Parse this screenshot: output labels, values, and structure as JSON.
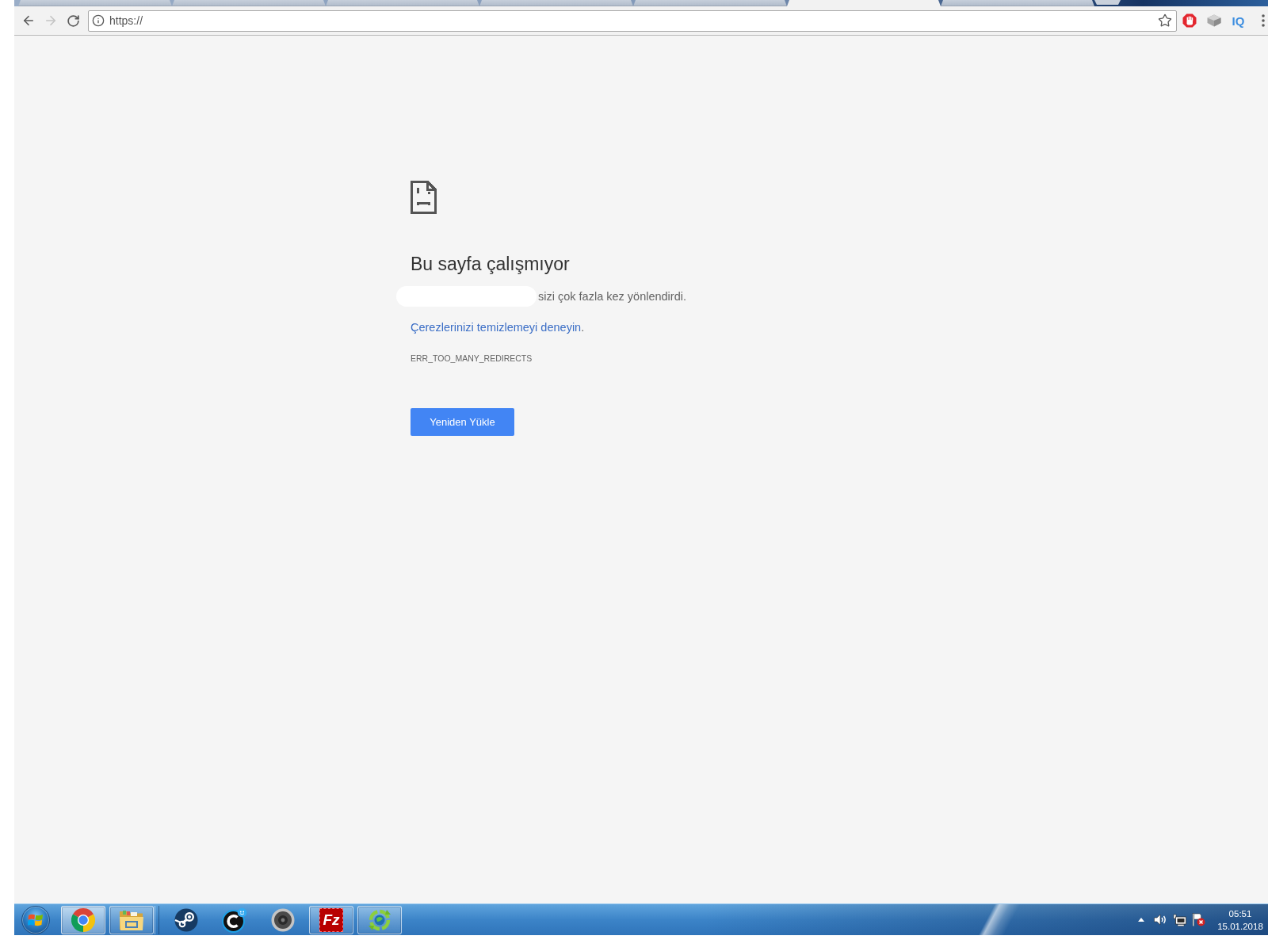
{
  "tabs": [
    {
      "selected": false
    },
    {
      "selected": false
    },
    {
      "selected": false
    },
    {
      "selected": false
    },
    {
      "selected": false
    },
    {
      "selected": true
    },
    {
      "selected": false
    }
  ],
  "nav_buttons": [
    {
      "kind": "back",
      "disabled": false
    },
    {
      "kind": "forward",
      "disabled": true
    },
    {
      "kind": "reload",
      "disabled": false
    }
  ],
  "address_bar": {
    "url": "https://"
  },
  "extension_label": "IQ",
  "error_page": {
    "heading": "Bu sayfa çalışmıyor",
    "message": "sizi çok fazla kez yönlendirdi.",
    "suggestion_link": "Çerezlerinizi temizlemeyi deneyin",
    "suggestion_end": ".",
    "error_code": "ERR_TOO_MANY_REDIRECTS",
    "button": "Yeniden Yükle"
  },
  "taskbar": {
    "items": [
      {
        "kind": "browser",
        "running": true,
        "active": true
      },
      {
        "kind": "folder",
        "running": true,
        "active": false
      },
      {
        "kind": "round-logo",
        "running": false,
        "active": false
      },
      {
        "kind": "ring-logo",
        "running": false,
        "active": false
      },
      {
        "kind": "speaker",
        "running": false,
        "active": false
      },
      {
        "kind": "tile-logo",
        "label": "Fz",
        "running": true,
        "active": false
      },
      {
        "kind": "arrows-globe",
        "running": true,
        "active": false
      }
    ],
    "clock": {
      "time": "05:51",
      "date": "15.01.2018"
    }
  }
}
